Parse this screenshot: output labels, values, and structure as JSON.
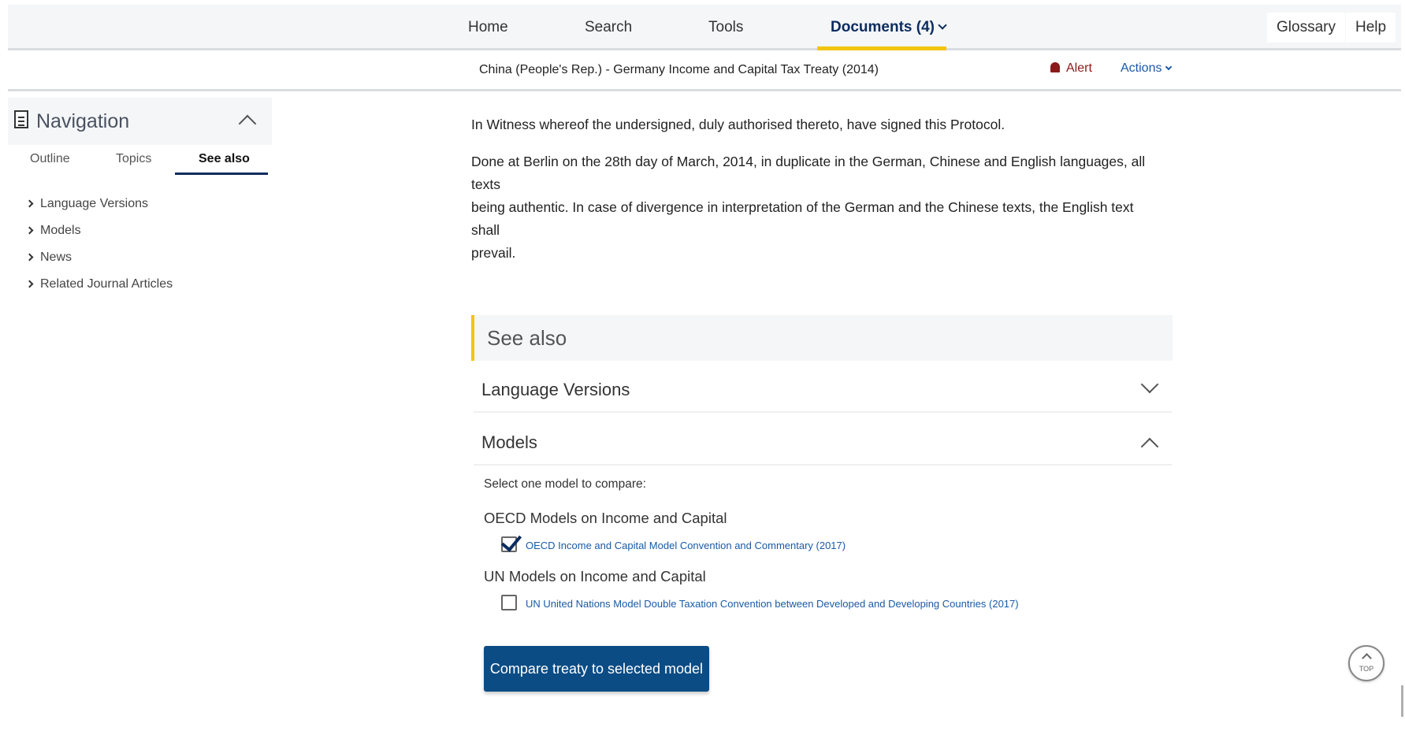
{
  "topnav": {
    "items": [
      {
        "label": "Home"
      },
      {
        "label": "Search"
      },
      {
        "label": "Tools"
      },
      {
        "label": "Documents (4)"
      }
    ],
    "glossary": "Glossary",
    "help": "Help"
  },
  "docbar": {
    "title": "China (People's Rep.) - Germany Income and Capital Tax Treaty (2014)",
    "alert": "Alert",
    "actions": "Actions"
  },
  "navigation": {
    "title": "Navigation",
    "tabs": [
      "Outline",
      "Topics",
      "See also"
    ],
    "active_tab": "See also",
    "links": [
      "Language Versions",
      "Models",
      "News",
      "Related Journal Articles"
    ]
  },
  "content": {
    "para1": "In Witness whereof the undersigned, duly authorised thereto, have signed this Protocol.",
    "para2_lines": [
      "Done at Berlin on the 28th day of March, 2014, in duplicate in the German, Chinese and English languages, all texts",
      "being authentic. In case of divergence in interpretation of the German and the Chinese texts, the English text shall",
      "prevail."
    ]
  },
  "see_also": {
    "heading": "See also",
    "sections": [
      {
        "label": "Language Versions",
        "expanded": false
      },
      {
        "label": "Models",
        "expanded": true
      }
    ],
    "instruction": "Select one model to compare:",
    "groups": [
      {
        "title": "OECD Models on Income and Capital",
        "model": "OECD Income and Capital Model Convention and Commentary (2017)",
        "checked": true
      },
      {
        "title": "UN Models on Income and Capital",
        "model": "UN United Nations Model Double Taxation Convention between Developed and Developing Countries (2017)",
        "checked": false
      }
    ],
    "compare_button": "Compare treaty to selected model"
  },
  "top_button": "TOP",
  "colors": {
    "accent_yellow": "#f2c511",
    "primary_blue": "#0b4c85",
    "link_blue": "#1a5aa6",
    "alert_red": "#8b1a1a"
  }
}
